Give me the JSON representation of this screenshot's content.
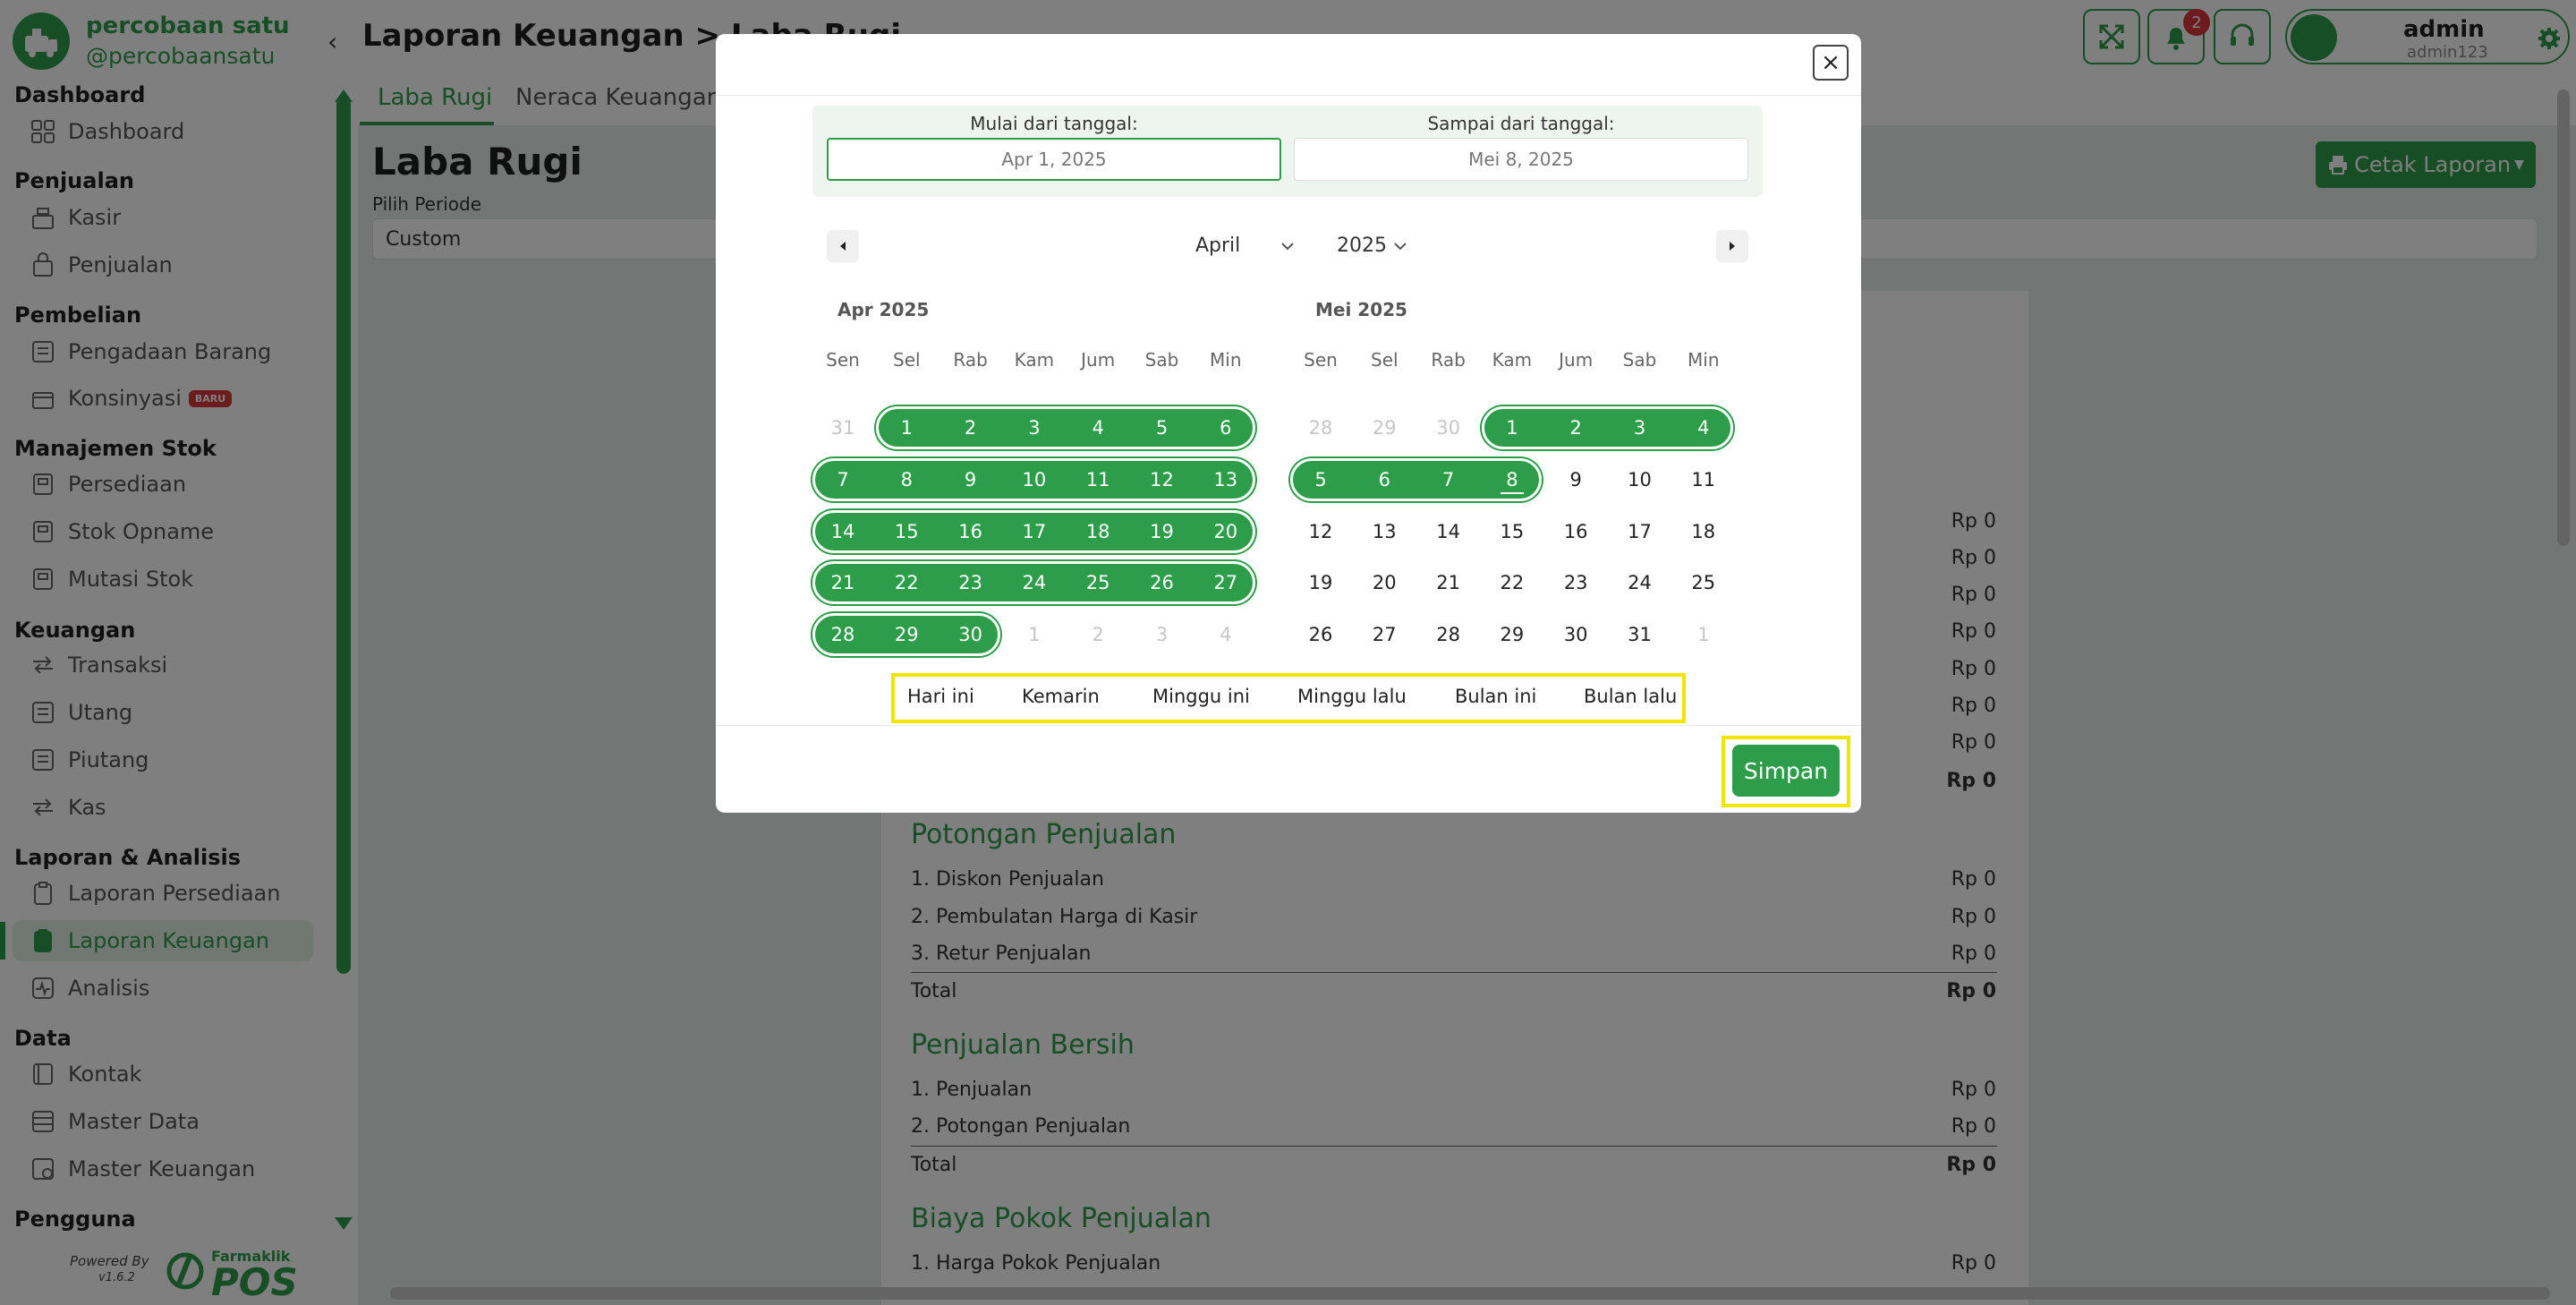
{
  "brand": {
    "name": "percobaan satu",
    "handle": "@percobaansatu"
  },
  "sidebar": {
    "sections": [
      {
        "title": "Dashboard",
        "items": [
          {
            "label": "Dashboard",
            "icon": "grid-icon"
          }
        ]
      },
      {
        "title": "Penjualan",
        "items": [
          {
            "label": "Kasir",
            "icon": "cashier-icon"
          },
          {
            "label": "Penjualan",
            "icon": "bag-icon"
          }
        ]
      },
      {
        "title": "Pembelian",
        "items": [
          {
            "label": "Pengadaan Barang",
            "icon": "procurement-icon"
          },
          {
            "label": "Konsinyasi",
            "icon": "consignment-icon",
            "badge": "BARU"
          }
        ]
      },
      {
        "title": "Manajemen Stok",
        "items": [
          {
            "label": "Persediaan",
            "icon": "inventory-icon"
          },
          {
            "label": "Stok Opname",
            "icon": "stock-opname-icon"
          },
          {
            "label": "Mutasi Stok",
            "icon": "stock-mutation-icon"
          }
        ]
      },
      {
        "title": "Keuangan",
        "items": [
          {
            "label": "Transaksi",
            "icon": "transaction-icon"
          },
          {
            "label": "Utang",
            "icon": "debt-icon"
          },
          {
            "label": "Piutang",
            "icon": "receivable-icon"
          },
          {
            "label": "Kas",
            "icon": "cash-icon"
          }
        ]
      },
      {
        "title": "Laporan & Analisis",
        "items": [
          {
            "label": "Laporan Persediaan",
            "icon": "clipboard-icon"
          },
          {
            "label": "Laporan Keuangan",
            "icon": "clipboard-icon",
            "active": true
          },
          {
            "label": "Analisis",
            "icon": "analytics-icon"
          }
        ]
      },
      {
        "title": "Data",
        "items": [
          {
            "label": "Kontak",
            "icon": "contact-icon"
          },
          {
            "label": "Master Data",
            "icon": "database-icon"
          },
          {
            "label": "Master Keuangan",
            "icon": "finance-icon"
          }
        ]
      },
      {
        "title": "Pengguna",
        "items": []
      }
    ],
    "powered_by": "Powered By",
    "version": "v1.6.2",
    "footer_brand_small": "Farmaklik",
    "footer_brand_big": "POS"
  },
  "header": {
    "breadcrumb": "Laporan Keuangan > Laba Rugi",
    "notif_count": "2",
    "user_name": "admin",
    "user_login": "admin123"
  },
  "tabs": [
    {
      "label": "Laba Rugi",
      "active": true
    },
    {
      "label": "Neraca Keuangan",
      "active": false
    }
  ],
  "page": {
    "title": "Laba Rugi",
    "period_label": "Pilih Periode",
    "period_value": "Custom",
    "print_button": "Cetak Laporan"
  },
  "report": {
    "blank_values": [
      "Rp 0",
      "Rp 0",
      "Rp 0",
      "Rp 0",
      "Rp 0",
      "Rp 0",
      "Rp 0"
    ],
    "blank_total": "Rp 0",
    "sections": [
      {
        "title": "Potongan Penjualan",
        "rows": [
          {
            "label": "1. Diskon Penjualan",
            "value": "Rp 0"
          },
          {
            "label": "2. Pembulatan Harga di Kasir",
            "value": "Rp 0"
          },
          {
            "label": "3. Retur Penjualan",
            "value": "Rp 0"
          }
        ],
        "total_label": "Total",
        "total_value": "Rp 0"
      },
      {
        "title": "Penjualan Bersih",
        "rows": [
          {
            "label": "1. Penjualan",
            "value": "Rp 0"
          },
          {
            "label": "2. Potongan Penjualan",
            "value": "Rp 0"
          }
        ],
        "total_label": "Total",
        "total_value": "Rp 0"
      },
      {
        "title": "Biaya Pokok Penjualan",
        "rows": [
          {
            "label": "1. Harga Pokok Penjualan",
            "value": "Rp 0"
          }
        ]
      }
    ]
  },
  "modal": {
    "close_label": "×",
    "start_label": "Mulai dari tanggal:",
    "start_value": "Apr 1, 2025",
    "end_label": "Sampai dari tanggal:",
    "end_value": "Mei 8, 2025",
    "month_select": "April",
    "year_select": "2025",
    "weekdays": [
      "Sen",
      "Sel",
      "Rab",
      "Kam",
      "Jum",
      "Sab",
      "Min"
    ],
    "calendars": [
      {
        "title": "Apr 2025",
        "weeks": [
          [
            {
              "d": "31",
              "m": true
            },
            {
              "d": "1",
              "s": true
            },
            {
              "d": "2",
              "s": true
            },
            {
              "d": "3",
              "s": true
            },
            {
              "d": "4",
              "s": true
            },
            {
              "d": "5",
              "s": true
            },
            {
              "d": "6",
              "s": true
            }
          ],
          [
            {
              "d": "7",
              "s": true
            },
            {
              "d": "8",
              "s": true
            },
            {
              "d": "9",
              "s": true
            },
            {
              "d": "10",
              "s": true
            },
            {
              "d": "11",
              "s": true
            },
            {
              "d": "12",
              "s": true
            },
            {
              "d": "13",
              "s": true
            }
          ],
          [
            {
              "d": "14",
              "s": true
            },
            {
              "d": "15",
              "s": true
            },
            {
              "d": "16",
              "s": true
            },
            {
              "d": "17",
              "s": true
            },
            {
              "d": "18",
              "s": true
            },
            {
              "d": "19",
              "s": true
            },
            {
              "d": "20",
              "s": true
            }
          ],
          [
            {
              "d": "21",
              "s": true
            },
            {
              "d": "22",
              "s": true
            },
            {
              "d": "23",
              "s": true
            },
            {
              "d": "24",
              "s": true
            },
            {
              "d": "25",
              "s": true
            },
            {
              "d": "26",
              "s": true
            },
            {
              "d": "27",
              "s": true
            }
          ],
          [
            {
              "d": "28",
              "s": true
            },
            {
              "d": "29",
              "s": true
            },
            {
              "d": "30",
              "s": true
            },
            {
              "d": "1",
              "m": true
            },
            {
              "d": "2",
              "m": true
            },
            {
              "d": "3",
              "m": true
            },
            {
              "d": "4",
              "m": true
            }
          ]
        ]
      },
      {
        "title": "Mei 2025",
        "weeks": [
          [
            {
              "d": "28",
              "m": true
            },
            {
              "d": "29",
              "m": true
            },
            {
              "d": "30",
              "m": true
            },
            {
              "d": "1",
              "s": true
            },
            {
              "d": "2",
              "s": true
            },
            {
              "d": "3",
              "s": true
            },
            {
              "d": "4",
              "s": true
            }
          ],
          [
            {
              "d": "5",
              "s": true
            },
            {
              "d": "6",
              "s": true
            },
            {
              "d": "7",
              "s": true
            },
            {
              "d": "8",
              "s": true,
              "today": true
            },
            {
              "d": "9"
            },
            {
              "d": "10"
            },
            {
              "d": "11"
            }
          ],
          [
            {
              "d": "12"
            },
            {
              "d": "13"
            },
            {
              "d": "14"
            },
            {
              "d": "15"
            },
            {
              "d": "16"
            },
            {
              "d": "17"
            },
            {
              "d": "18"
            }
          ],
          [
            {
              "d": "19"
            },
            {
              "d": "20"
            },
            {
              "d": "21"
            },
            {
              "d": "22"
            },
            {
              "d": "23"
            },
            {
              "d": "24"
            },
            {
              "d": "25"
            }
          ],
          [
            {
              "d": "26"
            },
            {
              "d": "27"
            },
            {
              "d": "28"
            },
            {
              "d": "29"
            },
            {
              "d": "30"
            },
            {
              "d": "31"
            },
            {
              "d": "1",
              "m": true
            }
          ]
        ]
      }
    ],
    "quick_ranges": [
      "Hari ini",
      "Kemarin",
      "Minggu ini",
      "Minggu lalu",
      "Bulan ini",
      "Bulan lalu"
    ],
    "save_button": "Simpan"
  },
  "colors": {
    "primary": "#2e9d4a",
    "badge": "#d9363e",
    "highlight": "#f2e600"
  }
}
